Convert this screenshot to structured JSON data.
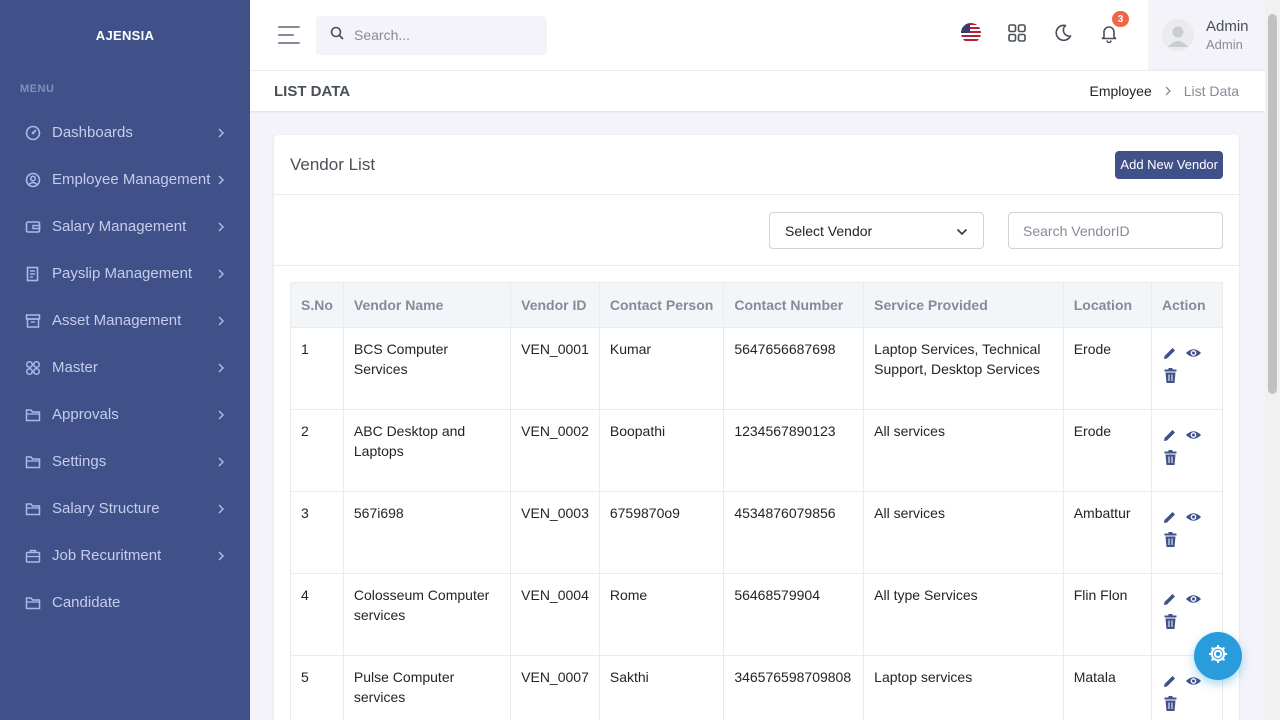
{
  "brand": "AJENSIA",
  "menu_title": "MENU",
  "sidebar": {
    "items": [
      {
        "label": "Dashboards",
        "icon": "dashboard-icon"
      },
      {
        "label": "Employee Management",
        "icon": "user-circle-icon"
      },
      {
        "label": "Salary Management",
        "icon": "wallet-icon"
      },
      {
        "label": "Payslip Management",
        "icon": "document-icon"
      },
      {
        "label": "Asset Management",
        "icon": "archive-icon"
      },
      {
        "label": "Master",
        "icon": "apps-icon"
      },
      {
        "label": "Approvals",
        "icon": "folder-icon"
      },
      {
        "label": "Settings",
        "icon": "folder-icon"
      },
      {
        "label": "Salary Structure",
        "icon": "folder-icon"
      },
      {
        "label": "Job Recuritment",
        "icon": "briefcase-icon"
      },
      {
        "label": "Candidate",
        "icon": "folder-icon"
      }
    ]
  },
  "topbar": {
    "search_placeholder": "Search...",
    "notification_count": "3",
    "user_name": "Admin",
    "user_role": "Admin"
  },
  "page": {
    "title": "LIST DATA",
    "breadcrumb_parent": "Employee",
    "breadcrumb_current": "List Data"
  },
  "card": {
    "title": "Vendor List",
    "add_button": "Add New Vendor",
    "select_vendor": "Select Vendor",
    "search_placeholder": "Search VendorID"
  },
  "table": {
    "headers": [
      "S.No",
      "Vendor Name",
      "Vendor ID",
      "Contact Person",
      "Contact Number",
      "Service Provided",
      "Location",
      "Action"
    ],
    "rows": [
      [
        "1",
        "BCS Computer Services",
        "VEN_0001",
        "Kumar",
        "5647656687698",
        "Laptop Services, Technical Support, Desktop Services",
        "Erode"
      ],
      [
        "2",
        "ABC Desktop and Laptops",
        "VEN_0002",
        "Boopathi",
        "1234567890123",
        "All services",
        "Erode"
      ],
      [
        "3",
        "567i698",
        "VEN_0003",
        "6759870o9",
        "4534876079856",
        "All services",
        "Ambattur"
      ],
      [
        "4",
        "Colosseum Computer services",
        "VEN_0004",
        "Rome",
        "56468579904",
        "All type Services",
        "Flin Flon"
      ],
      [
        "5",
        "Pulse Computer services",
        "VEN_0007",
        "Sakthi",
        "346576598709808",
        "Laptop services",
        "Matala"
      ]
    ]
  },
  "colors": {
    "sidebar_bg": "#405189",
    "primary": "#405189",
    "badge": "#f06548",
    "fab": "#299cdb"
  }
}
